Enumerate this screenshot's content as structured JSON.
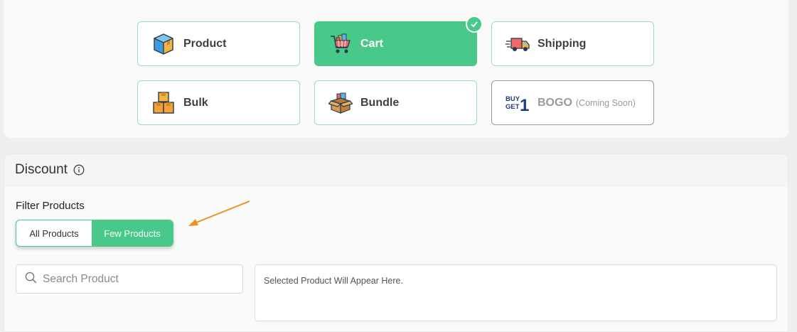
{
  "discount_types": [
    {
      "id": "product",
      "label": "Product",
      "icon": "product-box-icon",
      "state": "normal"
    },
    {
      "id": "cart",
      "label": "Cart",
      "icon": "shopping-cart-icon",
      "state": "active"
    },
    {
      "id": "shipping",
      "label": "Shipping",
      "icon": "delivery-truck-icon",
      "state": "normal"
    },
    {
      "id": "bulk",
      "label": "Bulk",
      "icon": "stacked-boxes-icon",
      "state": "normal"
    },
    {
      "id": "bundle",
      "label": "Bundle",
      "icon": "bundle-box-icon",
      "state": "normal"
    },
    {
      "id": "bogo",
      "label": "BOGO",
      "sublabel": "(Coming Soon)",
      "icon": "buy-get-1-icon",
      "icon_text": [
        "BUY",
        "GET",
        "1"
      ],
      "state": "disabled"
    }
  ],
  "discount": {
    "title": "Discount",
    "filter_label": "Filter Products",
    "filter_options": [
      "All Products",
      "Few Products"
    ],
    "selected_filter": "Few Products",
    "search_placeholder": "Search Product",
    "selected_placeholder": "Selected Product Will Appear Here."
  },
  "colors": {
    "accent": "#48c98a",
    "card_border": "#9fdcbd",
    "annotation_arrow": "#f0901e"
  }
}
